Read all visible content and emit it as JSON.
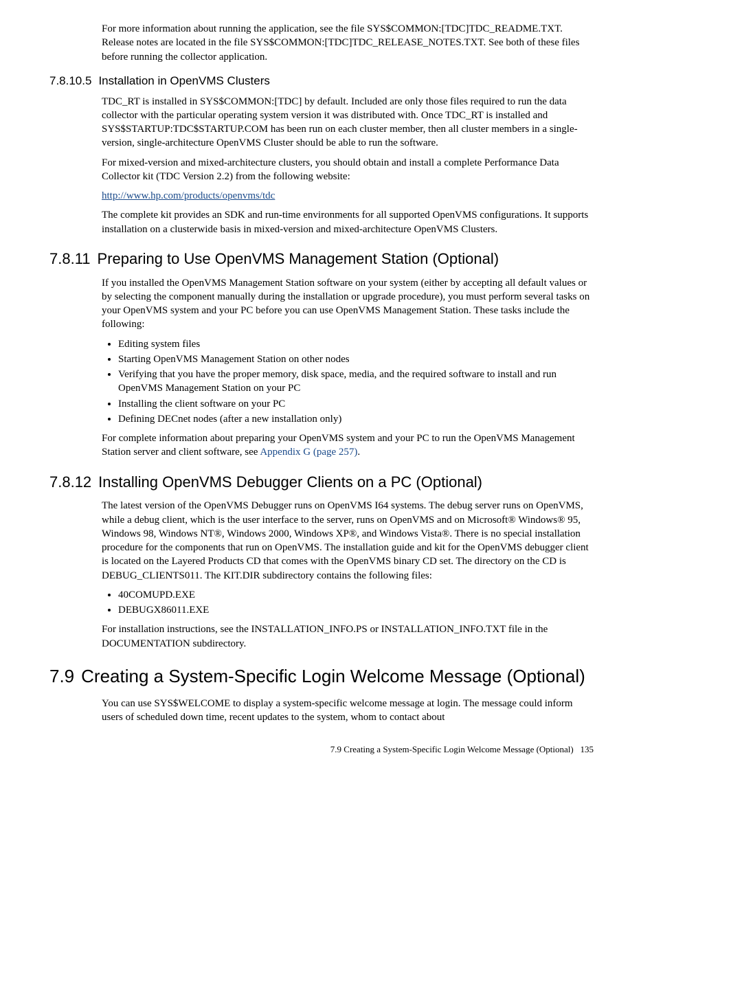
{
  "intro": {
    "p1": "For more information about running the application, see the file SYS$COMMON:[TDC]TDC_README.TXT. Release notes are located in the file SYS$COMMON:[TDC]TDC_RELEASE_NOTES.TXT. See both of these files before running the collector application."
  },
  "s78105": {
    "num": "7.8.10.5",
    "title": "Installation in OpenVMS Clusters",
    "p1": "TDC_RT is installed in SYS$COMMON:[TDC] by default. Included are only those files required to run the data collector with the particular operating system version it was distributed with. Once TDC_RT is installed and SYS$STARTUP:TDC$STARTUP.COM has been run on each cluster member, then all cluster members in a single-version, single-architecture OpenVMS Cluster should be able to run the software.",
    "p2": "For mixed-version and mixed-architecture clusters, you should obtain and install a complete Performance Data Collector kit (TDC Version 2.2) from the following website:",
    "link": "http://www.hp.com/products/openvms/tdc",
    "p3": "The complete kit provides an SDK and run-time environments for all supported OpenVMS configurations. It supports installation on a clusterwide basis in mixed-version and mixed-architecture OpenVMS Clusters."
  },
  "s7811": {
    "num": "7.8.11",
    "title": "Preparing to Use OpenVMS Management Station (Optional)",
    "p1": "If you installed the OpenVMS Management Station software on your system (either by accepting all default values or by selecting the component manually during the installation or upgrade procedure), you must perform several tasks on your OpenVMS system and your PC before you can use OpenVMS Management Station. These tasks include the following:",
    "bullets": [
      "Editing system files",
      "Starting OpenVMS Management Station on other nodes",
      "Verifying that you have the proper memory, disk space, media, and the required software to install and run OpenVMS Management Station on your PC",
      "Installing the client software on your PC",
      "Defining DECnet nodes (after a new installation only)"
    ],
    "p2a": "For complete information about preparing your OpenVMS system and your PC to run the OpenVMS Management Station server and client software, see ",
    "p2link": "Appendix G (page 257)",
    "p2b": "."
  },
  "s7812": {
    "num": "7.8.12",
    "title": "Installing OpenVMS Debugger Clients on a PC (Optional)",
    "p1": "The latest version of the OpenVMS Debugger runs on OpenVMS I64 systems. The debug server runs on OpenVMS, while a debug client, which is the user interface to the server, runs on OpenVMS and on Microsoft® Windows® 95, Windows 98, Windows NT®, Windows 2000, Windows XP®, and Windows Vista®. There is no special installation procedure for the components that run on OpenVMS. The installation guide and kit for the OpenVMS debugger client is located on the Layered Products CD that comes with the OpenVMS binary CD set. The directory on the CD is DEBUG_CLIENTS011. The KIT.DIR subdirectory contains the following files:",
    "bullets": [
      "40COMUPD.EXE",
      "DEBUGX86011.EXE"
    ],
    "p2": "For installation instructions, see the INSTALLATION_INFO.PS or INSTALLATION_INFO.TXT file in the DOCUMENTATION subdirectory."
  },
  "s79": {
    "num": "7.9",
    "title": "Creating a System-Specific Login Welcome Message (Optional)",
    "p1": "You can use SYS$WELCOME to display a system-specific welcome message at login. The message could inform users of scheduled down time, recent updates to the system, whom to contact about"
  },
  "footer": {
    "text": "7.9 Creating a System-Specific Login Welcome Message (Optional)",
    "page": "135"
  }
}
